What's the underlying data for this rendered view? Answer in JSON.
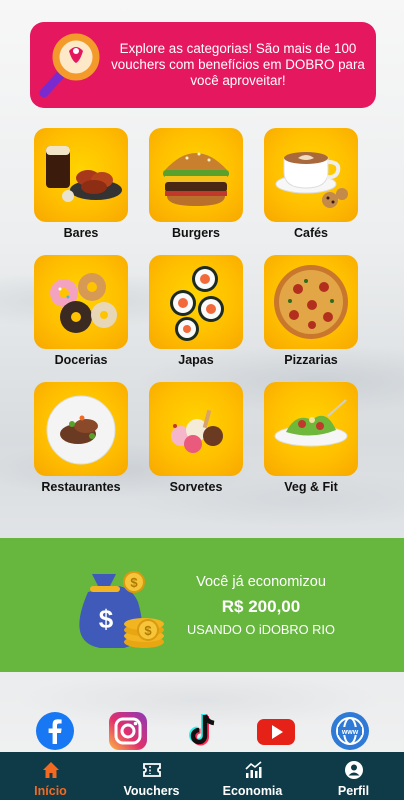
{
  "banner": {
    "text": "Explore as categorias! São mais de 100 vouchers com benefícios em DOBRO para você aproveitar!",
    "icon": "magnifier-icon"
  },
  "categories": [
    {
      "label": "Bares",
      "icon": "beer-wings-icon"
    },
    {
      "label": "Burgers",
      "icon": "burger-icon"
    },
    {
      "label": "Cafés",
      "icon": "coffee-icon"
    },
    {
      "label": "Docerias",
      "icon": "donuts-icon"
    },
    {
      "label": "Japas",
      "icon": "sushi-icon"
    },
    {
      "label": "Pizzarias",
      "icon": "pizza-icon"
    },
    {
      "label": "Restaurantes",
      "icon": "plate-icon"
    },
    {
      "label": "Sorvetes",
      "icon": "ice-cream-icon"
    },
    {
      "label": "Veg & Fit",
      "icon": "salad-icon"
    }
  ],
  "savings": {
    "line1": "Você já economizou",
    "amount": "R$ 200,00",
    "line3": "USANDO O iDOBRO RIO"
  },
  "social": [
    "facebook-icon",
    "instagram-icon",
    "tiktok-icon",
    "youtube-icon",
    "website-icon"
  ],
  "nav": {
    "items": [
      {
        "label": "Início",
        "icon": "home-icon",
        "active": true
      },
      {
        "label": "Vouchers",
        "icon": "ticket-icon"
      },
      {
        "label": "Economia",
        "icon": "chart-icon"
      },
      {
        "label": "Perfil",
        "icon": "user-icon"
      }
    ]
  },
  "colors": {
    "banner": "#e5175f",
    "tile": "#ffc400",
    "savings": "#67b73f",
    "nav": "#0f3a48",
    "active": "#f26a21"
  }
}
